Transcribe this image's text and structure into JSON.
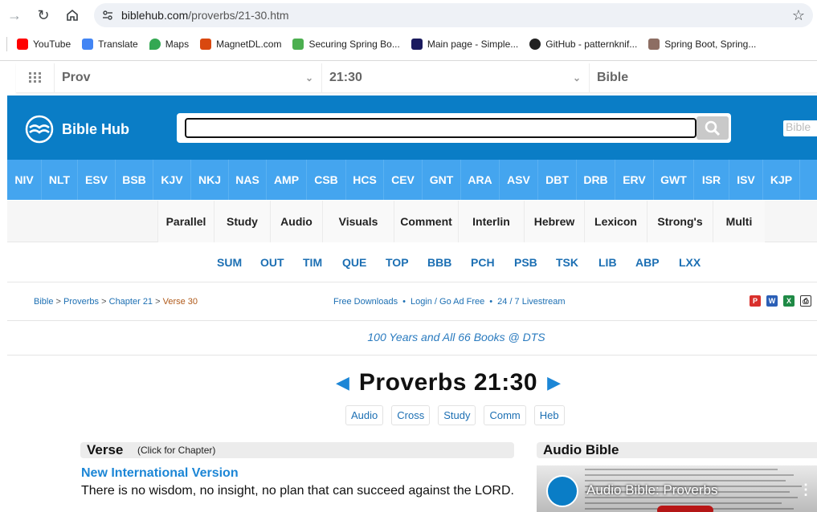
{
  "browser": {
    "url_domain": "biblehub.com",
    "url_path": "/proverbs/21-30.htm",
    "bookmarks": [
      {
        "label": "YouTube",
        "color": "#ff0000"
      },
      {
        "label": "Translate",
        "color": "#4285f4"
      },
      {
        "label": "Maps",
        "color": "#34a853"
      },
      {
        "label": "MagnetDL.com",
        "color": "#d9480f"
      },
      {
        "label": "Securing Spring Bo...",
        "color": "#4caf50"
      },
      {
        "label": "Main page - Simple...",
        "color": "#1a1a5e"
      },
      {
        "label": "GitHub - patternknif...",
        "color": "#222222"
      },
      {
        "label": "Spring Boot, Spring...",
        "color": "#8d6e63"
      }
    ]
  },
  "selectors": {
    "book": "Prov",
    "chapter_verse": "21:30",
    "version": "Bible"
  },
  "header": {
    "logo_text": "Bible Hub",
    "bible_button": "Bible",
    "brand_color": "#0a7dc6"
  },
  "versions": [
    "NIV",
    "NLT",
    "ESV",
    "BSB",
    "KJV",
    "NKJ",
    "NAS",
    "AMP",
    "CSB",
    "HCS",
    "CEV",
    "GNT",
    "ARA",
    "ASV",
    "DBT",
    "DRB",
    "ERV",
    "GWT",
    "ISR",
    "ISV",
    "KJP"
  ],
  "tools": [
    "Parallel",
    "Study",
    "Audio",
    "Visuals",
    "Comment",
    "Interlin",
    "Hebrew",
    "Lexicon",
    "Strong's",
    "Multi"
  ],
  "resources": [
    "SUM",
    "OUT",
    "TIM",
    "QUE",
    "TOP",
    "BBB",
    "PCH",
    "PSB",
    "TSK",
    "LIB",
    "ABP",
    "LXX"
  ],
  "breadcrumb": {
    "bible": "Bible",
    "book": "Proverbs",
    "chapter": "Chapter 21",
    "verse": "Verse 30",
    "sep": ">"
  },
  "links": {
    "free_downloads": "Free Downloads",
    "login": "Login / Go Ad Free",
    "livestream": "24 / 7 Livestream"
  },
  "download_icons": [
    "pdf-icon",
    "word-icon",
    "excel-icon",
    "print-icon"
  ],
  "promo": "100 Years and All 66 Books @ DTS",
  "chapter": {
    "title": "Proverbs 21:30",
    "prev": "◀",
    "next": "▶"
  },
  "subnav": [
    "Audio",
    "Cross",
    "Study",
    "Comm",
    "Heb"
  ],
  "verse_section": {
    "heading": "Verse",
    "subheading": "(Click for Chapter)",
    "version_name": "New International Version",
    "text": "There is no wisdom, no insight, no plan that can succeed against the LORD."
  },
  "audio_section": {
    "heading": "Audio Bible",
    "video_title": "Audio Bible: Proverbs"
  }
}
